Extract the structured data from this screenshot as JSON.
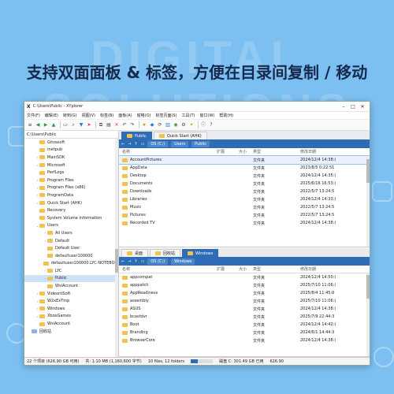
{
  "background_word": "DIGITAL SOLUTIONS",
  "headline": "支持双面面板 & 标签，方便在目录间复制 / 移动",
  "window": {
    "title": "C:\\Users\\Public - XYplorer",
    "logo": "X",
    "menu": [
      "文件(F)",
      "编辑(E)",
      "转到(G)",
      "视图(V)",
      "标签(B)",
      "面板(A)",
      "窗格(O)",
      "标签页面(S)",
      "工具(T)",
      "窗口(W)",
      "帮助(H)"
    ]
  },
  "tree": {
    "address": "C:\\Users\\Public",
    "nodes": [
      {
        "label": "Gitzasoft",
        "arrow": "",
        "indent": 1,
        "blue": false
      },
      {
        "label": "inetpub",
        "arrow": "",
        "indent": 1,
        "blue": false
      },
      {
        "label": "MainSDK",
        "arrow": "›",
        "indent": 1,
        "blue": false
      },
      {
        "label": "Microsoft",
        "arrow": "›",
        "indent": 1,
        "blue": false
      },
      {
        "label": "PerfLogs",
        "arrow": "",
        "indent": 1,
        "blue": false
      },
      {
        "label": "Program Files",
        "arrow": "›",
        "indent": 1,
        "blue": false
      },
      {
        "label": "Program Files (x86)",
        "arrow": "›",
        "indent": 1,
        "blue": false
      },
      {
        "label": "ProgramData",
        "arrow": "›",
        "indent": 1,
        "blue": false
      },
      {
        "label": "Quick Start (AHK)",
        "arrow": "›",
        "indent": 1,
        "blue": false
      },
      {
        "label": "Recovery",
        "arrow": "",
        "indent": 1,
        "blue": false
      },
      {
        "label": "System Volume Information",
        "arrow": "",
        "indent": 1,
        "blue": false
      },
      {
        "label": "Users",
        "arrow": "⌄",
        "indent": 1,
        "blue": false
      },
      {
        "label": "All Users",
        "arrow": "›",
        "indent": 2,
        "blue": false
      },
      {
        "label": "Default",
        "arrow": "›",
        "indent": 2,
        "blue": false
      },
      {
        "label": "Default User",
        "arrow": "",
        "indent": 2,
        "blue": false
      },
      {
        "label": "defaultuser100000",
        "arrow": "",
        "indent": 2,
        "blue": false
      },
      {
        "label": "defaultuser100000.LYC-NOTEBOOK",
        "arrow": "",
        "indent": 2,
        "blue": false
      },
      {
        "label": "LYC",
        "arrow": "›",
        "indent": 2,
        "blue": false
      },
      {
        "label": "Public",
        "arrow": "›",
        "indent": 2,
        "blue": false,
        "selected": true
      },
      {
        "label": "WsiAccount",
        "arrow": "",
        "indent": 2,
        "blue": false
      },
      {
        "label": "VideoritSoft",
        "arrow": "›",
        "indent": 1,
        "blue": false
      },
      {
        "label": "W2xExTmp",
        "arrow": "›",
        "indent": 1,
        "blue": false
      },
      {
        "label": "Windows",
        "arrow": "›",
        "indent": 1,
        "blue": false
      },
      {
        "label": "XboxGames",
        "arrow": "›",
        "indent": 1,
        "blue": false
      },
      {
        "label": "WsiAccount",
        "arrow": "",
        "indent": 1,
        "blue": false
      },
      {
        "label": "回收站",
        "arrow": "",
        "indent": 0,
        "blue": true
      }
    ]
  },
  "pane1": {
    "tabs": [
      {
        "label": "Public",
        "active": true
      },
      {
        "label": "Quick Start (AHK)",
        "active": false
      }
    ],
    "breadcrumb": [
      "OS (C:)",
      "Users",
      "Public"
    ],
    "columns": {
      "name": "名称",
      "ext": "扩展",
      "size": "大小",
      "type": "类型",
      "modified": "修改日期"
    },
    "rows": [
      {
        "name": "AccountPictures",
        "type": "文件夹",
        "date": "2024/12/4 14:38:(",
        "sel": true
      },
      {
        "name": "AppData",
        "type": "文件夹",
        "date": "2023/8/5 0:22:51"
      },
      {
        "name": "Desktop",
        "type": "文件夹",
        "date": "2024/12/4 14:35:("
      },
      {
        "name": "Documents",
        "type": "文件夹",
        "date": "2025/6/16 16:53:("
      },
      {
        "name": "Downloads",
        "type": "文件夹",
        "date": "2022/5/7 13:24:5"
      },
      {
        "name": "Libraries",
        "type": "文件夹",
        "date": "2024/12/4 14:33:("
      },
      {
        "name": "Music",
        "type": "文件夹",
        "date": "2022/5/7 13:24:5"
      },
      {
        "name": "Pictures",
        "type": "文件夹",
        "date": "2022/5/7 13:24:5"
      },
      {
        "name": "Recorded TV",
        "type": "文件夹",
        "date": "2024/12/4 14:38:("
      }
    ]
  },
  "pane2": {
    "tabs": [
      {
        "label": "桌面",
        "active": false
      },
      {
        "label": "回收站",
        "active": false
      },
      {
        "label": "Windows",
        "active": true
      }
    ],
    "breadcrumb": [
      "OS (C:)",
      "Windows"
    ],
    "columns": {
      "name": "名称",
      "ext": "扩展",
      "size": "大小",
      "type": "类型",
      "modified": "修改日期"
    },
    "rows": [
      {
        "name": "appcompat",
        "type": "文件夹",
        "date": "2024/12/4 14:50:("
      },
      {
        "name": "apppatch",
        "type": "文件夹",
        "date": "2025/7/10 11:06:("
      },
      {
        "name": "AppReadiness",
        "type": "文件夹",
        "date": "2025/8/4 11:45:0"
      },
      {
        "name": "assembly",
        "type": "文件夹",
        "date": "2025/7/10 11:06:("
      },
      {
        "name": "ASUS",
        "type": "文件夹",
        "date": "2024/12/4 14:38:("
      },
      {
        "name": "bcastdvr",
        "type": "文件夹",
        "date": "2025/7/9 22:44:3"
      },
      {
        "name": "Boot",
        "type": "文件夹",
        "date": "2024/12/4 14:42:("
      },
      {
        "name": "Branding",
        "type": "文件夹",
        "date": "2024/6/1 14:44:3"
      },
      {
        "name": "BrowserCore",
        "type": "文件夹",
        "date": "2024/12/4 14:38:("
      }
    ]
  },
  "status": {
    "left": "22 个项目 (626.90 GB 可用)",
    "sel": "共: 1.10 MB (1,160,600 字节)",
    "count": "10 files, 12 folders",
    "disk": "磁盘 C: 301.49 GB 已用",
    "free": "626.90",
    "used_fraction": 0.32
  },
  "colors": {
    "accent": "#2e6db5",
    "folder": "#f2c14e",
    "background": "#7cc0f1"
  }
}
